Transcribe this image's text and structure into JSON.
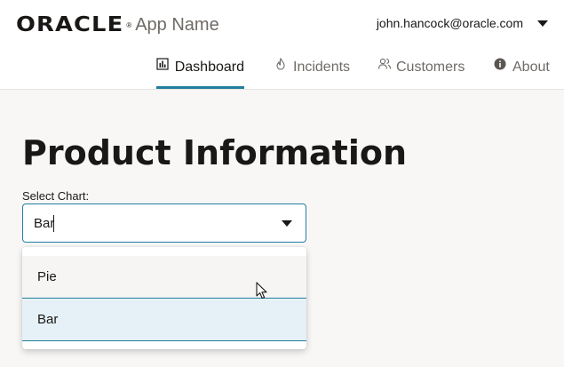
{
  "header": {
    "logo_text": "ORACLE",
    "logo_mark": "®",
    "app_name": "App Name",
    "user_email": "john.hancock@oracle.com"
  },
  "nav": {
    "items": [
      {
        "label": "Dashboard",
        "icon": "bar-chart-icon",
        "active": true
      },
      {
        "label": "Incidents",
        "icon": "flame-icon",
        "active": false
      },
      {
        "label": "Customers",
        "icon": "people-icon",
        "active": false
      },
      {
        "label": "About",
        "icon": "info-icon",
        "active": false
      }
    ]
  },
  "main": {
    "title": "Product Information",
    "select_label": "Select Chart:",
    "select_value": "Bar",
    "options": [
      {
        "label": "Pie",
        "state": "hover"
      },
      {
        "label": "Bar",
        "state": "selected"
      }
    ]
  },
  "colors": {
    "accent": "#227e9e",
    "selected_option_bg": "#e5f1f6",
    "page_bg": "#f8f7f6"
  }
}
